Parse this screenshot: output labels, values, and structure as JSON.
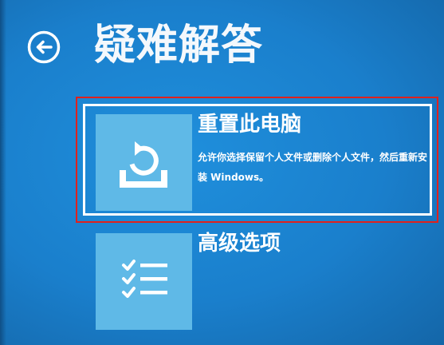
{
  "header": {
    "back_icon": "back-arrow-circle-icon",
    "title": "疑难解答"
  },
  "options": [
    {
      "id": "reset-pc",
      "icon": "reset-pc-icon",
      "title": "重置此电脑",
      "description": "允许你选择保留个人文件或删除个人文件，然后重新安装 Windows。",
      "selected": true
    },
    {
      "id": "advanced-options",
      "icon": "checklist-icon",
      "title": "高级选项",
      "description": "",
      "selected": false
    }
  ],
  "colors": {
    "background": "#1a7fcc",
    "tile": "#5fb9e7",
    "highlight": "#e0211d",
    "text": "#ffffff"
  }
}
